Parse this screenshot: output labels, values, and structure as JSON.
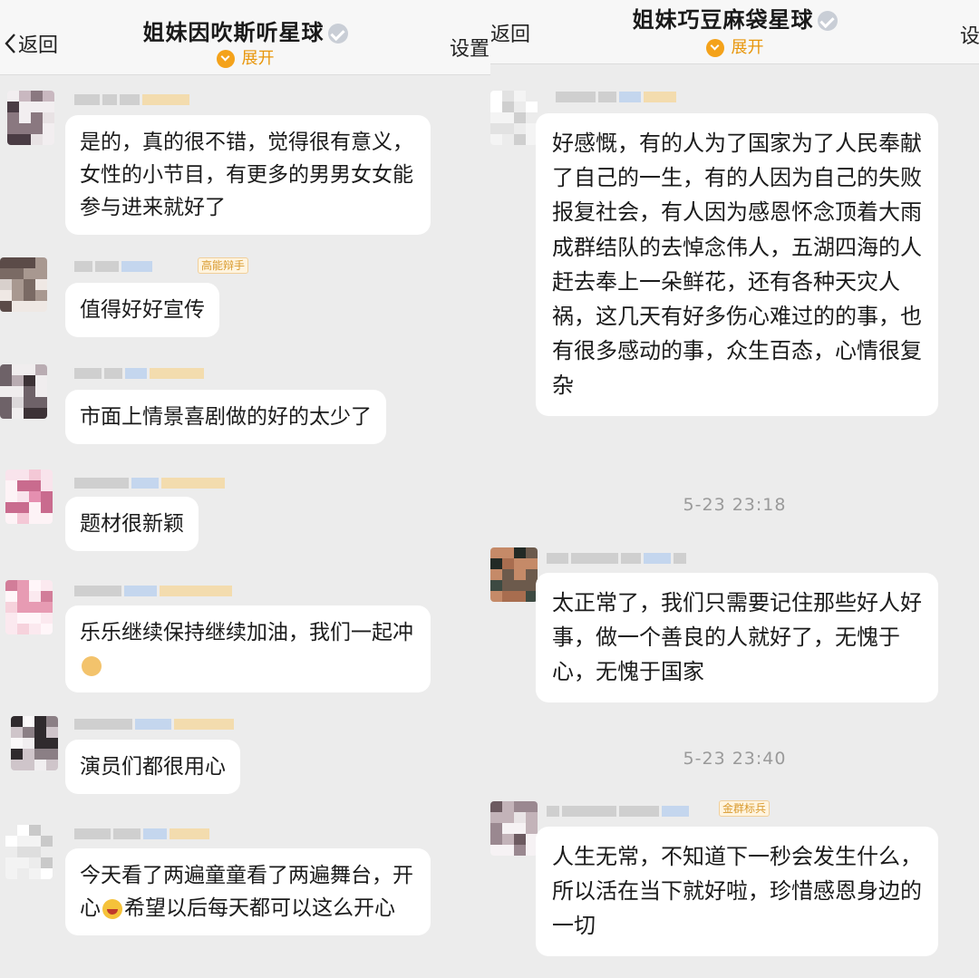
{
  "left": {
    "header": {
      "back_label": "返回",
      "title": "姐妹因吹斯听星球",
      "expand_label": "展开",
      "settings_label": "设置"
    },
    "messages": [
      {
        "tag": "",
        "text": "是的，真的很不错，觉得很有意义，女性的小节目，有更多的男男女女能参与进来就好了",
        "avatar_palette": [
          "#e8e2e4",
          "#4a3c44",
          "#c9b8c0",
          "#f2eef0",
          "#8a7880"
        ]
      },
      {
        "tag": "高能辩手",
        "text": "值得好好宣传",
        "avatar_palette": [
          "#d8d0cc",
          "#5b4b48",
          "#a89890",
          "#efe8e4",
          "#7a6a64"
        ]
      },
      {
        "tag": "",
        "text": "市面上情景喜剧做的好的太少了",
        "avatar_palette": [
          "#dcd8da",
          "#3c3236",
          "#b9acb2",
          "#f0edee",
          "#6e6268"
        ]
      },
      {
        "tag": "",
        "text": "题材很新颖",
        "avatar_palette": [
          "#f4c8d6",
          "#e58fb0",
          "#f9e4ec",
          "#c96b8e",
          "#fdf3f6"
        ]
      },
      {
        "tag": "",
        "text_before_emoji": "乐乐继续保持继续加油，我们一起冲",
        "emoji": "fist",
        "avatar_palette": [
          "#f6d2dc",
          "#e79bb3",
          "#fbe9ef",
          "#d27d99",
          "#fff6f9"
        ]
      },
      {
        "tag": "",
        "text": "演员们都很用心",
        "avatar_palette": [
          "#f1eef0",
          "#2f2a2d",
          "#cfc5ca",
          "#faf8f9",
          "#8b7f85"
        ]
      },
      {
        "tag": "",
        "line1": "今天看了两遍童童看了两遍舞台，开心",
        "emoji": "laugh",
        "line2": "希望以后每天都可以这么开心",
        "avatar_palette": [
          "#f3f3f3",
          "#dedede",
          "#ffffff",
          "#c9c9c9",
          "#ececec"
        ]
      }
    ]
  },
  "right": {
    "header": {
      "back_label": "返回",
      "title": "姐妹巧豆麻袋星球",
      "expand_label": "展开",
      "settings_label": "设"
    },
    "messages": [
      {
        "tag": "",
        "text": "好感慨，有的人为了国家为了人民奉献了自己的一生，有的人因为自己的失败报复社会，有人因为感恩怀念顶着大雨成群结队的去悼念伟人，五湖四海的人赶去奉上一朵鲜花，还有各种天灾人祸，这几天有好多伤心难过的的事，也有很多感动的事，众生百态，心情很复杂",
        "avatar_palette": [
          "#f4f4f4",
          "#e2e2e2",
          "#ffffff",
          "#cfcfcf",
          "#ececec"
        ]
      },
      {
        "time": "5-23 23:18"
      },
      {
        "tag": "",
        "text": "太正常了，我们只需要记住那些好人好事，做一个善良的人就好了，无愧于心，无愧于国家",
        "avatar_palette": [
          "#3d4a42",
          "#a86d4f",
          "#222a25",
          "#c58a68",
          "#6c5a4c"
        ]
      },
      {
        "time": "5-23 23:40"
      },
      {
        "tag": "金群标兵",
        "text": "人生无常，不知道下一秒会发生什么，所以活在当下就好啦，珍惜感恩身边的一切",
        "avatar_palette": [
          "#e9e4e6",
          "#6c5a60",
          "#c3b3b9",
          "#f6f2f4",
          "#9a8890"
        ]
      }
    ]
  }
}
